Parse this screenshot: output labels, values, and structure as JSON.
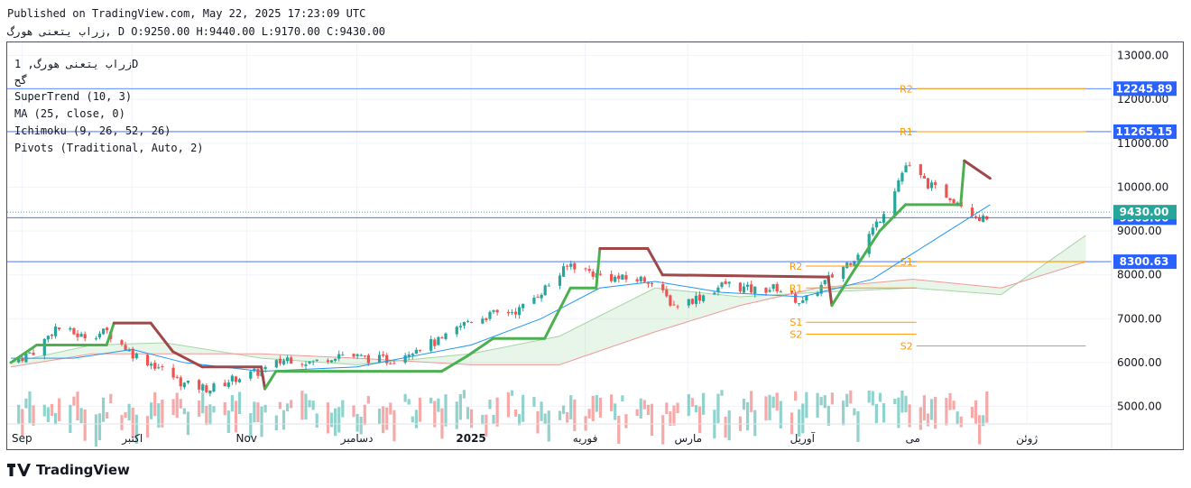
{
  "header": {
    "published": "Published on TradingView.com, May 22, 2025 17:23:09 UTC",
    "ohlc_line": "زراب  یتعنی  هورگ, D O:9250.00 H:9440.00 L:9170.00 C:9430.00"
  },
  "legend": {
    "symbol_line": "زراب  یتعنی  هورگ, 1D",
    "symbol_line2": "گح",
    "supertrend": "SuperTrend (10, 3)",
    "ma": "MA (25, close, 0)",
    "ichimoku": "Ichimoku (9, 26, 52, 26)",
    "pivots": "Pivots (Traditional, Auto, 2)"
  },
  "brand": {
    "name": "TradingView"
  },
  "colors": {
    "up": "#26a69a",
    "down": "#ef5350",
    "supertrend_up": "#4caf50",
    "supertrend_down": "#a04747",
    "ma": "#2196f3",
    "pivot": "#ff9800",
    "hline": "#2962ff",
    "price_tag": "#26a69a"
  },
  "chart_data": {
    "type": "candlestick",
    "y_axis": {
      "range": [
        4600,
        13300
      ],
      "ticks": [
        5000,
        6000,
        7000,
        8000,
        9000,
        10000,
        11000,
        12000,
        13000
      ],
      "tick_labels": [
        "5000.00",
        "6000.00",
        "7000.00",
        "8000.00",
        "9000.00",
        "10000.00",
        "11000.00",
        "12000.00",
        "13000.00"
      ]
    },
    "x_axis": {
      "labels": [
        {
          "text": "Sep",
          "date": "2024-09-01",
          "bold": false
        },
        {
          "text": "اکتبر",
          "date": "2024-10-01",
          "bold": false
        },
        {
          "text": "Nov",
          "date": "2024-11-01",
          "bold": false
        },
        {
          "text": "دسامبر",
          "date": "2024-12-01",
          "bold": false
        },
        {
          "text": "2025",
          "date": "2025-01-01",
          "bold": true
        },
        {
          "text": "فوریه",
          "date": "2025-02-01",
          "bold": false
        },
        {
          "text": "مارس",
          "date": "2025-03-01",
          "bold": false
        },
        {
          "text": "آوریل",
          "date": "2025-04-01",
          "bold": false
        },
        {
          "text": "می",
          "date": "2025-05-01",
          "bold": false
        },
        {
          "text": "ژوئن",
          "date": "2025-06-01",
          "bold": false
        }
      ]
    },
    "price_series": [
      {
        "date": "2024-08-29",
        "close": 6000
      },
      {
        "date": "2024-09-05",
        "close": 6300
      },
      {
        "date": "2024-09-10",
        "close": 6800
      },
      {
        "date": "2024-09-17",
        "close": 6600
      },
      {
        "date": "2024-09-24",
        "close": 6700
      },
      {
        "date": "2024-10-01",
        "close": 6200
      },
      {
        "date": "2024-10-08",
        "close": 5900
      },
      {
        "date": "2024-10-15",
        "close": 5500
      },
      {
        "date": "2024-10-22",
        "close": 5400
      },
      {
        "date": "2024-10-29",
        "close": 5650
      },
      {
        "date": "2024-11-05",
        "close": 5800
      },
      {
        "date": "2024-11-12",
        "close": 6100
      },
      {
        "date": "2024-11-19",
        "close": 6000
      },
      {
        "date": "2024-11-26",
        "close": 6200
      },
      {
        "date": "2024-12-03",
        "close": 6100
      },
      {
        "date": "2024-12-10",
        "close": 6050
      },
      {
        "date": "2024-12-17",
        "close": 6350
      },
      {
        "date": "2024-12-24",
        "close": 6500
      },
      {
        "date": "2024-12-31",
        "close": 6950
      },
      {
        "date": "2025-01-07",
        "close": 7100
      },
      {
        "date": "2025-01-14",
        "close": 7200
      },
      {
        "date": "2025-01-21",
        "close": 7700
      },
      {
        "date": "2025-01-28",
        "close": 8250
      },
      {
        "date": "2025-02-04",
        "close": 8000
      },
      {
        "date": "2025-02-11",
        "close": 7900
      },
      {
        "date": "2025-02-18",
        "close": 7900
      },
      {
        "date": "2025-02-25",
        "close": 7300
      },
      {
        "date": "2025-03-04",
        "close": 7500
      },
      {
        "date": "2025-03-11",
        "close": 7800
      },
      {
        "date": "2025-03-18",
        "close": 7650
      },
      {
        "date": "2025-03-25",
        "close": 7700
      },
      {
        "date": "2025-04-01",
        "close": 7350
      },
      {
        "date": "2025-04-08",
        "close": 7900
      },
      {
        "date": "2025-04-15",
        "close": 8400
      },
      {
        "date": "2025-04-22",
        "close": 9300
      },
      {
        "date": "2025-04-29",
        "close": 10500
      },
      {
        "date": "2025-05-06",
        "close": 10000
      },
      {
        "date": "2025-05-13",
        "close": 9700
      },
      {
        "date": "2025-05-20",
        "close": 9250
      },
      {
        "date": "2025-05-22",
        "close": 9430
      }
    ],
    "supertrend": [
      {
        "date": "2024-08-29",
        "value": 6000,
        "trend": "up"
      },
      {
        "date": "2024-09-05",
        "value": 6400,
        "trend": "up"
      },
      {
        "date": "2024-09-24",
        "value": 6400,
        "trend": "up"
      },
      {
        "date": "2024-09-26",
        "value": 6900,
        "trend": "down"
      },
      {
        "date": "2024-10-06",
        "value": 6900,
        "trend": "down"
      },
      {
        "date": "2024-10-12",
        "value": 6250,
        "trend": "down"
      },
      {
        "date": "2024-10-20",
        "value": 5900,
        "trend": "down"
      },
      {
        "date": "2024-11-05",
        "value": 5900,
        "trend": "down"
      },
      {
        "date": "2024-11-06",
        "value": 5400,
        "trend": "up"
      },
      {
        "date": "2024-11-09",
        "value": 5800,
        "trend": "up"
      },
      {
        "date": "2024-12-24",
        "value": 5800,
        "trend": "up"
      },
      {
        "date": "2024-12-31",
        "value": 6150,
        "trend": "up"
      },
      {
        "date": "2025-01-07",
        "value": 6550,
        "trend": "up"
      },
      {
        "date": "2025-01-21",
        "value": 6550,
        "trend": "up"
      },
      {
        "date": "2025-01-28",
        "value": 7700,
        "trend": "up"
      },
      {
        "date": "2025-02-04",
        "value": 7700,
        "trend": "up"
      },
      {
        "date": "2025-02-05",
        "value": 8600,
        "trend": "down"
      },
      {
        "date": "2025-02-18",
        "value": 8600,
        "trend": "down"
      },
      {
        "date": "2025-02-22",
        "value": 8000,
        "trend": "down"
      },
      {
        "date": "2025-04-08",
        "value": 7950,
        "trend": "down"
      },
      {
        "date": "2025-04-09",
        "value": 7300,
        "trend": "up"
      },
      {
        "date": "2025-04-15",
        "value": 8100,
        "trend": "up"
      },
      {
        "date": "2025-04-22",
        "value": 9000,
        "trend": "up"
      },
      {
        "date": "2025-04-29",
        "value": 9600,
        "trend": "up"
      },
      {
        "date": "2025-05-14",
        "value": 9600,
        "trend": "up"
      },
      {
        "date": "2025-05-15",
        "value": 10600,
        "trend": "down"
      },
      {
        "date": "2025-05-22",
        "value": 10200,
        "trend": "down"
      }
    ],
    "ma25": [
      {
        "date": "2024-08-29",
        "value": 6100
      },
      {
        "date": "2024-09-15",
        "value": 6100
      },
      {
        "date": "2024-10-01",
        "value": 6300
      },
      {
        "date": "2024-10-15",
        "value": 6000
      },
      {
        "date": "2024-11-05",
        "value": 5800
      },
      {
        "date": "2024-12-01",
        "value": 5900
      },
      {
        "date": "2025-01-01",
        "value": 6400
      },
      {
        "date": "2025-01-20",
        "value": 7000
      },
      {
        "date": "2025-02-05",
        "value": 7700
      },
      {
        "date": "2025-02-20",
        "value": 7850
      },
      {
        "date": "2025-03-10",
        "value": 7600
      },
      {
        "date": "2025-04-01",
        "value": 7500
      },
      {
        "date": "2025-04-20",
        "value": 7900
      },
      {
        "date": "2025-05-05",
        "value": 8700
      },
      {
        "date": "2025-05-22",
        "value": 9600
      }
    ],
    "cloud": [
      {
        "date": "2024-08-29",
        "a": 6000,
        "b": 5900
      },
      {
        "date": "2024-09-20",
        "a": 6400,
        "b": 6200
      },
      {
        "date": "2024-10-10",
        "a": 6450,
        "b": 6200
      },
      {
        "date": "2024-11-05",
        "a": 6100,
        "b": 6200
      },
      {
        "date": "2024-12-01",
        "a": 5950,
        "b": 6100
      },
      {
        "date": "2025-01-01",
        "a": 6200,
        "b": 5950
      },
      {
        "date": "2025-01-25",
        "a": 6600,
        "b": 5950
      },
      {
        "date": "2025-02-20",
        "a": 7700,
        "b": 6700
      },
      {
        "date": "2025-03-15",
        "a": 7500,
        "b": 7300
      },
      {
        "date": "2025-04-05",
        "a": 7600,
        "b": 7700
      },
      {
        "date": "2025-05-01",
        "a": 7700,
        "b": 7900
      },
      {
        "date": "2025-05-25",
        "a": 7550,
        "b": 7700
      },
      {
        "date": "2025-06-17",
        "a": 8900,
        "b": 8300
      }
    ],
    "horizontal_levels": [
      {
        "value": 12245.89,
        "label": "12245.89"
      },
      {
        "value": 11265.15,
        "label": "11265.15"
      },
      {
        "value": 8300.63,
        "label": "8300.63"
      },
      {
        "value": 9303.66,
        "label": "9303.66"
      }
    ],
    "last_price": {
      "value": 9430,
      "label": "9430.00"
    },
    "pivots": [
      {
        "label": "R2",
        "value": 12245,
        "from": "2025-05-02",
        "to": "2025-06-17"
      },
      {
        "label": "R1",
        "value": 11265,
        "from": "2025-05-02",
        "to": "2025-06-17"
      },
      {
        "label": "S1",
        "value": 8300,
        "from": "2025-05-02",
        "to": "2025-06-17"
      },
      {
        "label": "S2",
        "value": 6380,
        "from": "2025-05-02",
        "to": "2025-06-17"
      },
      {
        "label": "R2",
        "value": 8200,
        "from": "2025-04-02",
        "to": "2025-05-02"
      },
      {
        "label": "R1",
        "value": 7700,
        "from": "2025-04-02",
        "to": "2025-05-02"
      },
      {
        "label": "S1",
        "value": 6920,
        "from": "2025-04-02",
        "to": "2025-05-02"
      },
      {
        "label": "S2",
        "value": 6650,
        "from": "2025-04-02",
        "to": "2025-05-02"
      }
    ],
    "grid": true
  }
}
